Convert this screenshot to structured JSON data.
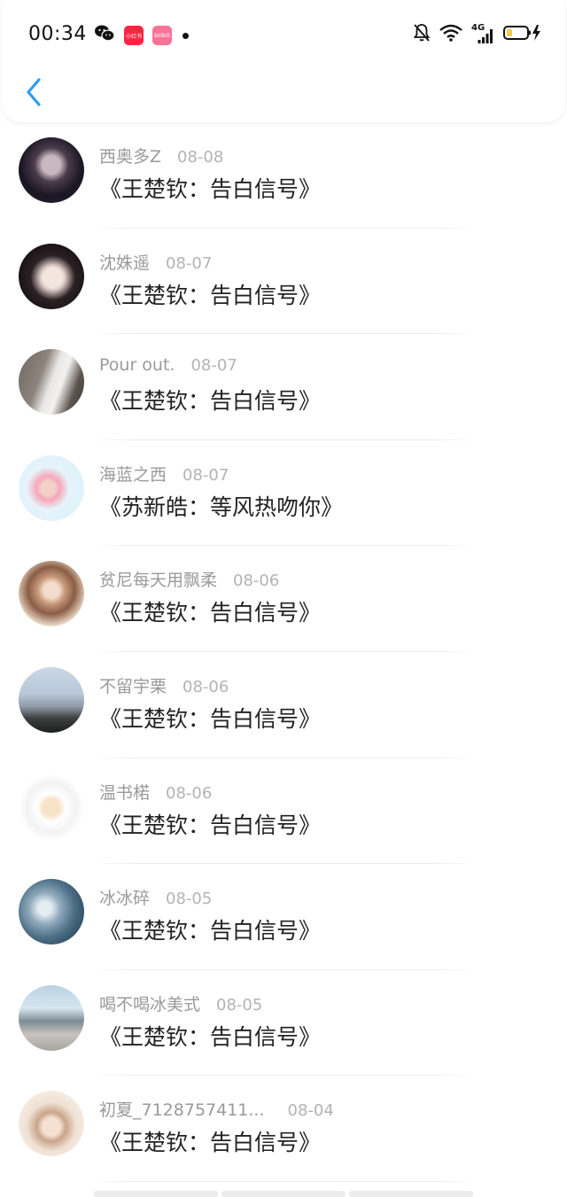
{
  "status_bar": {
    "time": "00:34",
    "apps": [
      {
        "name": "wechat-icon"
      },
      {
        "name": "xiaohongshu-icon",
        "label": "小红书",
        "color": "#ff2442"
      },
      {
        "name": "bilibili-icon",
        "label": "bilibili",
        "color": "#fb7299"
      }
    ],
    "network": "4G"
  },
  "header": {
    "back_icon": "chevron-left-icon",
    "accent": "#2e9cf3"
  },
  "items": [
    {
      "user": "西奥多Z",
      "date": "08-08",
      "title": "《王楚钦：告白信号》"
    },
    {
      "user": "沈姝遥",
      "date": "08-07",
      "title": "《王楚钦：告白信号》"
    },
    {
      "user": "Pour out.",
      "date": "08-07",
      "title": "《王楚钦：告白信号》"
    },
    {
      "user": "海蓝之西",
      "date": "08-07",
      "title": "《苏新皓：等风热吻你》"
    },
    {
      "user": "贫尼每天用飘柔",
      "date": "08-06",
      "title": "《王楚钦：告白信号》"
    },
    {
      "user": "不留宇栗",
      "date": "08-06",
      "title": "《王楚钦：告白信号》"
    },
    {
      "user": "温书楉",
      "date": "08-06",
      "title": "《王楚钦：告白信号》"
    },
    {
      "user": "冰冰碎",
      "date": "08-05",
      "title": "《王楚钦：告白信号》"
    },
    {
      "user": "喝不喝冰美式",
      "date": "08-05",
      "title": "《王楚钦：告白信号》"
    },
    {
      "user": "初夏_7128757411...",
      "date": "08-04",
      "title": "《王楚钦：告白信号》"
    }
  ]
}
